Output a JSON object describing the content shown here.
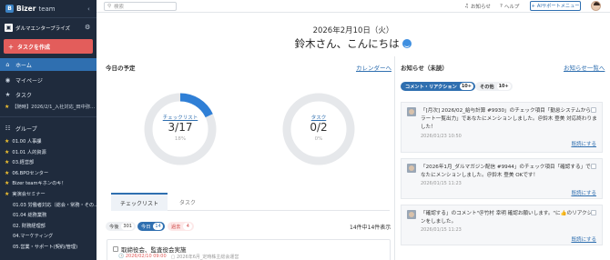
{
  "sidebar": {
    "brand": "Bizer",
    "brand_sub": "team",
    "org_name": "ダルマエンタープライズ",
    "create_task": "タスクを作成",
    "nav": [
      {
        "label": "ホーム",
        "icon": "home-icon"
      },
      {
        "label": "マイページ",
        "icon": "person-icon"
      },
      {
        "label": "タスク",
        "icon": "star-icon"
      }
    ],
    "task_sub": "【随時】2026/2/1_入社対応_田中弥…",
    "group_header": "グループ",
    "groups": [
      {
        "label": "01.00 人事課",
        "child": false
      },
      {
        "label": "01.01 人的資源",
        "child": false
      },
      {
        "label": "03.経営部",
        "child": false
      },
      {
        "label": "06.BPOセンター",
        "child": false
      },
      {
        "label": "Bizer teamキホンのキ！",
        "child": false
      },
      {
        "label": "実演会セミナー",
        "child": false
      },
      {
        "label": "01.03 労働者対応（総会・常務・その…",
        "child": true
      },
      {
        "label": "01.04 総務業務",
        "child": true
      },
      {
        "label": "02. 財務経理部",
        "child": true
      },
      {
        "label": "04.マーケティング",
        "child": true
      },
      {
        "label": "05.営業・サポート(契約/管理)",
        "child": true
      }
    ]
  },
  "topbar": {
    "search_placeholder": "検索",
    "notice": "お知らせ",
    "help": "ヘルプ",
    "support": "AIサポートメニュー"
  },
  "greeting": {
    "date": "2026年2月10日（火）",
    "message": "鈴木さん、こんにちは"
  },
  "schedule": {
    "title": "今日の予定",
    "calendar_link": "カレンダーへ",
    "donuts": [
      {
        "name": "チェックリスト",
        "value": "3/17",
        "percent_text": "18%",
        "fraction": 0.18,
        "color": "#2f7fd6"
      },
      {
        "name": "タスク",
        "value": "0/2",
        "percent_text": "0%",
        "fraction": 0.0,
        "color": "#2f7fd6"
      }
    ],
    "tabs": [
      "チェックリスト",
      "タスク"
    ],
    "filters": [
      {
        "label": "今後",
        "count": "301"
      },
      {
        "label": "今日",
        "count": "14"
      },
      {
        "label": "過去",
        "count": "4"
      }
    ],
    "count_text": "14件中14件表示",
    "task": {
      "title": "取締役会、監査役会実施",
      "due": "2026/02/10 09:00",
      "group": "2026年6月_定時株主総会運営"
    }
  },
  "notices": {
    "title": "お知らせ（未読）",
    "list_link": "お知らせ一覧へ",
    "tabs": [
      {
        "label": "コメント・リアクション",
        "count": "10+"
      },
      {
        "label": "その他",
        "count": "10+"
      }
    ],
    "items": [
      {
        "text": "「[月次] 2026/02_給与計算 #9930」のチェック項目「勤怠システムからアラート一覧出力」であなたにメンションしました。＠鈴木 登美 対応終わりました！",
        "date": "2026/01/23 10:50",
        "link": "既読にする"
      },
      {
        "text": "「2026年1月_ダルマガジン配信 #9944」のチェック項目「確認する」であなたにメンションしました。＠鈴木 登美 OKです！",
        "date": "2026/01/15 11:23",
        "link": "既読にする"
      },
      {
        "text": "「確認する」のコメント\"＠竹村 幸明 確認お願いします。\"に👍のリアクションをしました。",
        "date": "2026/01/15 11:23",
        "link": "既読にする"
      }
    ]
  },
  "colors": {
    "sidebar_bg": "#1f2b3d",
    "accent": "#2f6fb0",
    "create_btn": "#e35d5b"
  }
}
